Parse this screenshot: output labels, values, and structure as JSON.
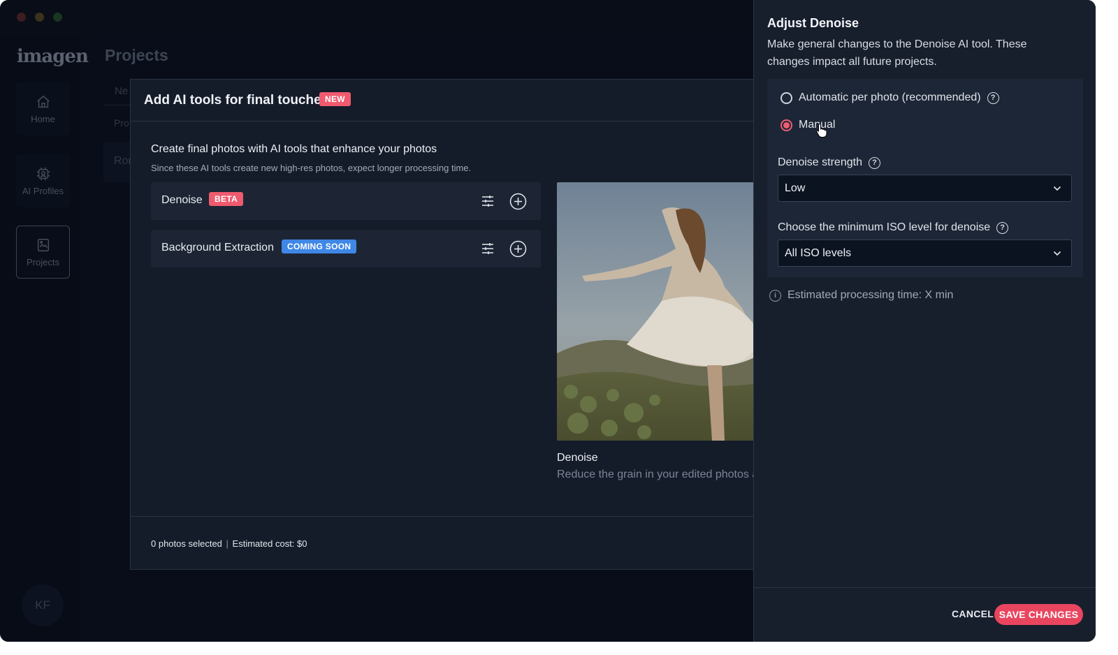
{
  "app": {
    "logo": "imagen"
  },
  "sidebar": {
    "items": [
      {
        "label": "Home",
        "icon": "home-icon"
      },
      {
        "label": "AI Profiles",
        "icon": "ai-profile-icon"
      },
      {
        "label": "Projects",
        "icon": "projects-icon",
        "active": true
      }
    ],
    "avatar_initials": "KF"
  },
  "background_page": {
    "title": "Projects",
    "tab_fragment": "Ne",
    "row_fragment": "Pro",
    "card_fragment": "Ror"
  },
  "modal": {
    "title": "Add AI tools for final touches",
    "title_badge": "NEW",
    "heading": "Create final photos with AI tools that enhance your photos",
    "subheading": "Since these AI tools create new high-res photos, expect longer processing time.",
    "tools": [
      {
        "label": "Denoise",
        "badge": "BETA",
        "badge_color": "#f05a6e"
      },
      {
        "label": "Background Extraction",
        "badge": "COMING SOON",
        "badge_color": "#3f87e6"
      }
    ],
    "preview": {
      "title": "Denoise",
      "description": "Reduce the grain in your edited photos a"
    },
    "footer": {
      "photos_selected": "0 photos selected",
      "separator": "|",
      "estimated_cost": "Estimated cost: $0"
    }
  },
  "panel": {
    "title": "Adjust Denoise",
    "description": "Make general changes to the Denoise AI tool. These changes impact all future projects.",
    "mode_options": [
      {
        "label": "Automatic per photo (recommended)",
        "checked": false,
        "help": true
      },
      {
        "label": "Manual",
        "checked": true,
        "help": false
      }
    ],
    "strength": {
      "label": "Denoise strength",
      "value": "Low"
    },
    "iso": {
      "label": "Choose the minimum ISO level for denoise",
      "value": "All ISO levels"
    },
    "estimate": "Estimated processing time: X min",
    "cancel_label": "CANCEL",
    "save_label": "SAVE CHANGES"
  },
  "colors": {
    "accent": "#e9455f",
    "background": "#0b1220",
    "panel": "#171f2d"
  }
}
